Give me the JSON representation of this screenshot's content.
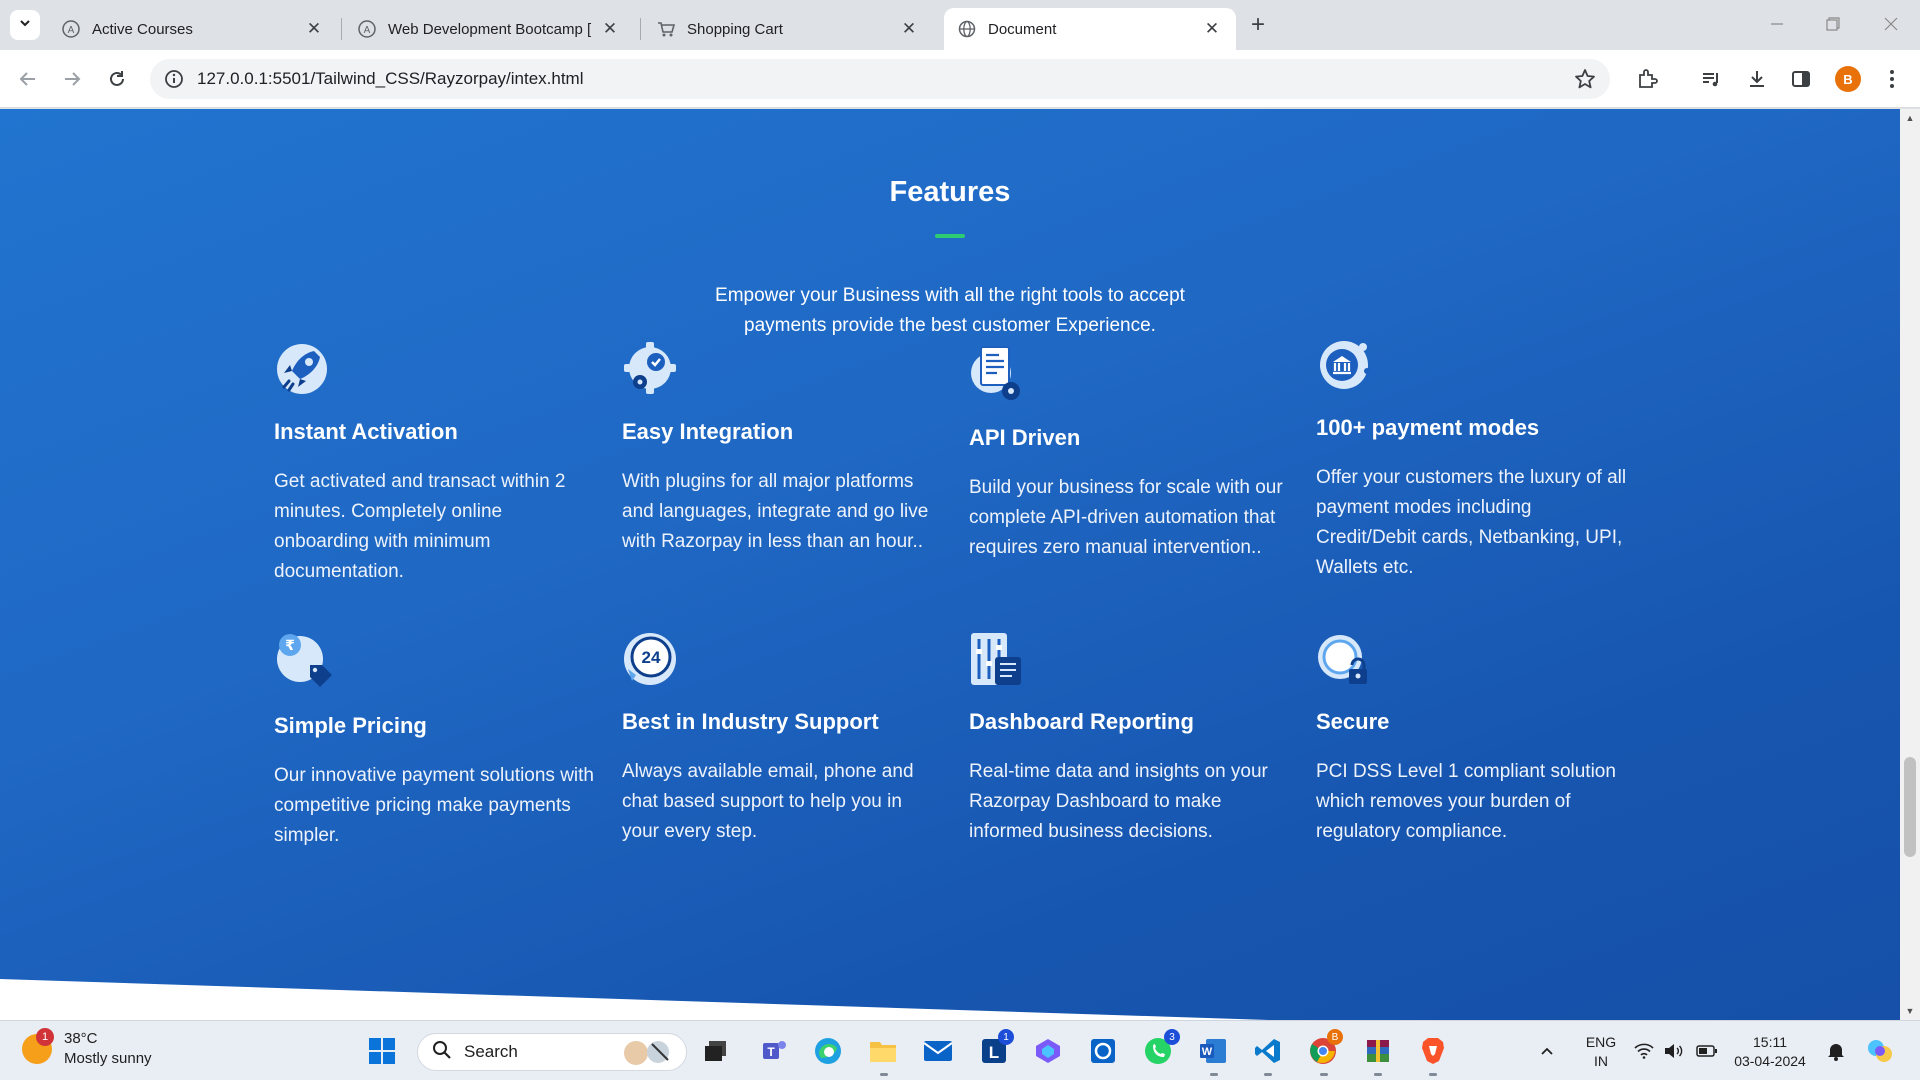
{
  "browser": {
    "tabs": [
      {
        "title": "Active Courses",
        "active": false
      },
      {
        "title": "Web Development Bootcamp [",
        "active": false
      },
      {
        "title": "Shopping Cart",
        "active": false
      },
      {
        "title": "Document",
        "active": true
      }
    ],
    "url": "127.0.0.1:5501/Tailwind_CSS/Rayzorpay/intex.html",
    "profile_initial": "B"
  },
  "page": {
    "title": "Features",
    "subtitle": "Empower your Business with all the right tools to accept payments provide the best customer Experience.",
    "features": [
      {
        "icon": "rocket-icon",
        "title": "Instant Activation",
        "desc": "Get activated and transact within 2 minutes. Completely online onboarding with minimum documentation."
      },
      {
        "icon": "gear-check-icon",
        "title": "Easy Integration",
        "desc": "With plugins for all major platforms and languages, integrate and go live with Razorpay in less than an hour.."
      },
      {
        "icon": "api-document-icon",
        "title": "API Driven",
        "desc": "Build your business for scale with our complete API-driven automation that requires zero manual intervention.."
      },
      {
        "icon": "bank-icon",
        "title": "100+ payment modes",
        "desc": "Offer your customers the luxury of all payment modes including Credit/Debit cards, Netbanking, UPI, Wallets etc."
      },
      {
        "icon": "rupee-tag-icon",
        "title": "Simple Pricing",
        "desc": "Our innovative payment solutions with competitive pricing make payments simpler."
      },
      {
        "icon": "support-24-icon",
        "title": "Best in Industry Support",
        "desc": "Always available email, phone and chat based support to help you in your every step."
      },
      {
        "icon": "dashboard-report-icon",
        "title": "Dashboard Reporting",
        "desc": "Real-time data and insights on your Razorpay Dashboard to make informed business decisions."
      },
      {
        "icon": "secure-lock-icon",
        "title": "Secure",
        "desc": "PCI DSS Level 1 compliant solution which removes your burden of regulatory compliance."
      }
    ]
  },
  "taskbar": {
    "weather_temp": "38°C",
    "weather_desc": "Mostly sunny",
    "weather_badge": "1",
    "search_label": "Search",
    "lang_top": "ENG",
    "lang_bottom": "IN",
    "time": "15:11",
    "date": "03-04-2024",
    "badges": {
      "linkedin": "1",
      "whatsapp": "3",
      "chrome": "B"
    }
  },
  "colors": {
    "page_blue": "#1f68c4",
    "accent_green": "#2ecc71",
    "icon_light": "#d8e8fb",
    "icon_dark": "#0d3f8c"
  }
}
